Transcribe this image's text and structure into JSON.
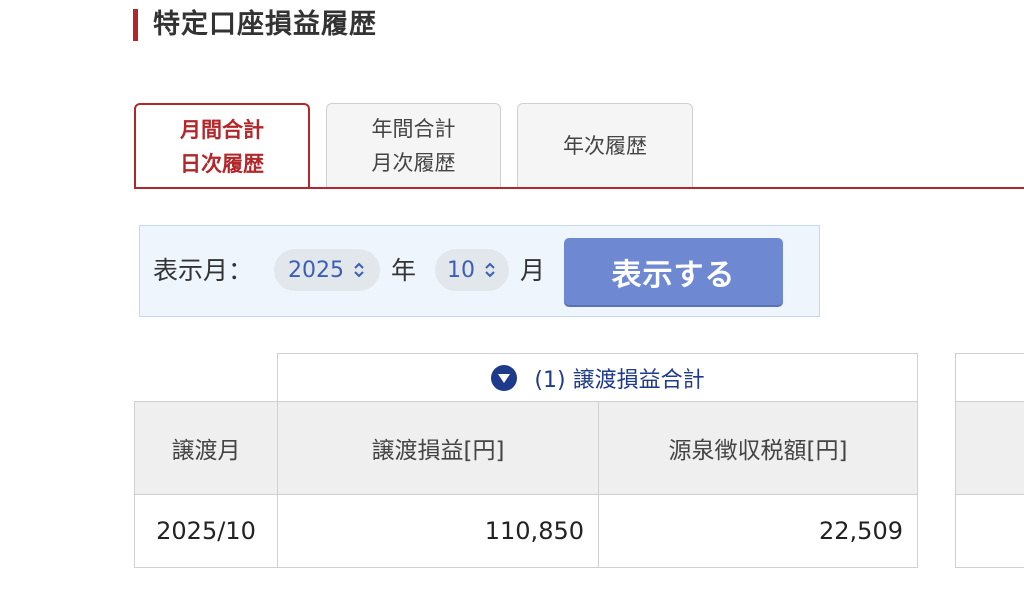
{
  "page": {
    "title": "特定口座損益履歴"
  },
  "tabs": [
    {
      "line1": "月間合計",
      "line2": "日次履歴",
      "active": true
    },
    {
      "line1": "年間合計",
      "line2": "月次履歴",
      "active": false
    },
    {
      "line1": "年次履歴",
      "line2": "",
      "active": false
    }
  ],
  "filter": {
    "label": "表示月：",
    "year_value": "2025",
    "year_unit": "年",
    "month_value": "10",
    "month_unit": "月",
    "submit_label": "表示する"
  },
  "table": {
    "group_header": "(1) 譲渡損益合計",
    "columns": [
      "譲渡月",
      "譲渡損益[円]",
      "源泉徴収税額[円]"
    ],
    "rows": [
      {
        "month": "2025/10",
        "gain": "110,850",
        "tax": "22,509"
      }
    ]
  },
  "colors": {
    "accent": "#b3262a",
    "button": "#6e89d2",
    "link": "#1e3a8a",
    "panel_bg": "#eef5fc"
  },
  "icons": {
    "group_toggle": "triangle-down-circle-icon",
    "select_chevron": "chevron-updown-icon"
  }
}
